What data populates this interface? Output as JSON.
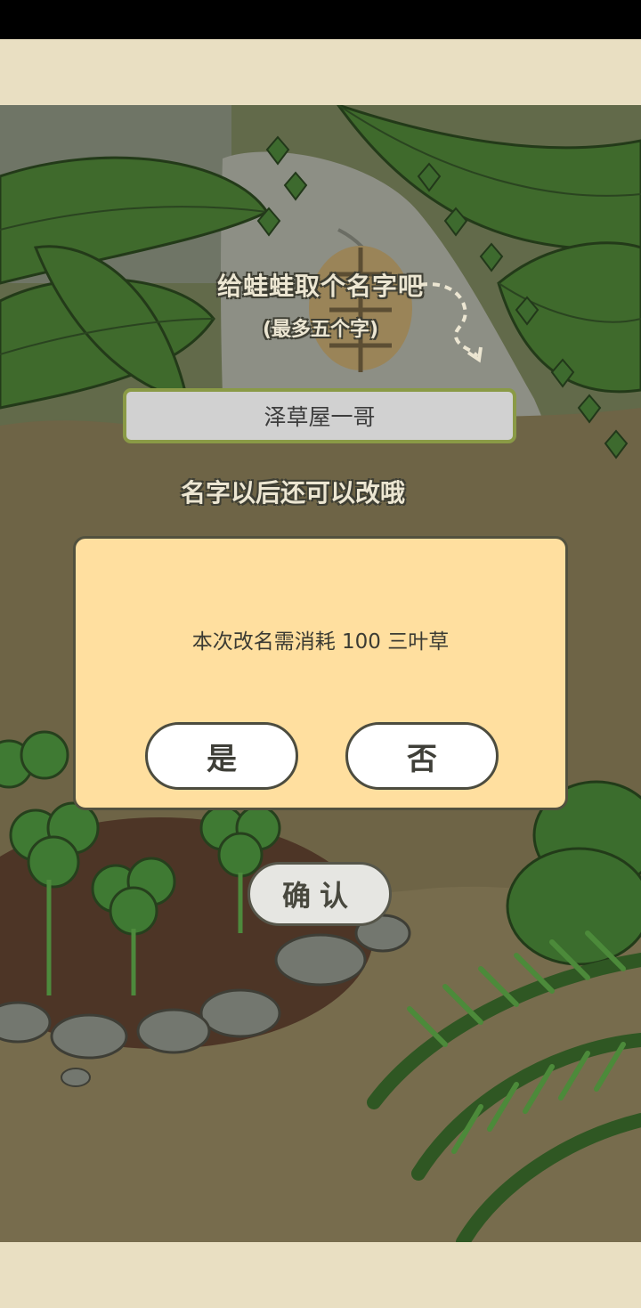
{
  "prompt": {
    "title": "给蛙蛙取个名字吧",
    "subtitle": "(最多五个字)",
    "hint": "名字以后还可以改哦"
  },
  "name_input": {
    "value": "泽草屋一哥"
  },
  "dialog": {
    "message": "本次改名需消耗 100 三叶草",
    "yes_label": "是",
    "no_label": "否"
  },
  "confirm_label": "确认",
  "colors": {
    "panel": "#ffdf9f",
    "input_border": "#8a9a46",
    "leaf": "#3f6a2c",
    "ground": "#6e6446"
  }
}
